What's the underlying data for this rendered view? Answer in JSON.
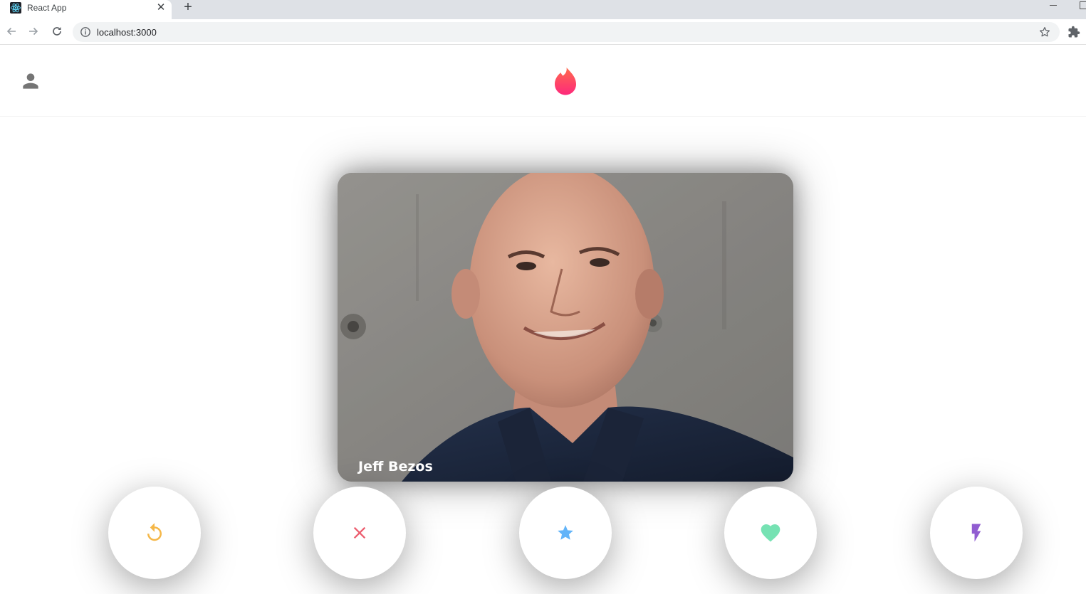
{
  "browser": {
    "tab_title": "React App",
    "tab_close": "✕",
    "new_tab": "+",
    "url": "localhost:3000"
  },
  "header": {
    "profile_icon": "person-icon",
    "logo_icon": "flame-logo-icon"
  },
  "card": {
    "name": "Jeff Bezos"
  },
  "buttons": [
    {
      "name": "replay-button",
      "icon": "replay-icon",
      "color": "#f5b748"
    },
    {
      "name": "dislike-button",
      "icon": "close-icon",
      "color": "#ec5e6f"
    },
    {
      "name": "superlike-button",
      "icon": "star-icon",
      "color": "#62b4f9"
    },
    {
      "name": "like-button",
      "icon": "heart-icon",
      "color": "#76e2b3"
    },
    {
      "name": "boost-button",
      "icon": "flash-icon",
      "color": "#915dd1"
    }
  ],
  "colors": {
    "logo_top": "#ff5864",
    "logo_bottom": "#fd297b"
  }
}
